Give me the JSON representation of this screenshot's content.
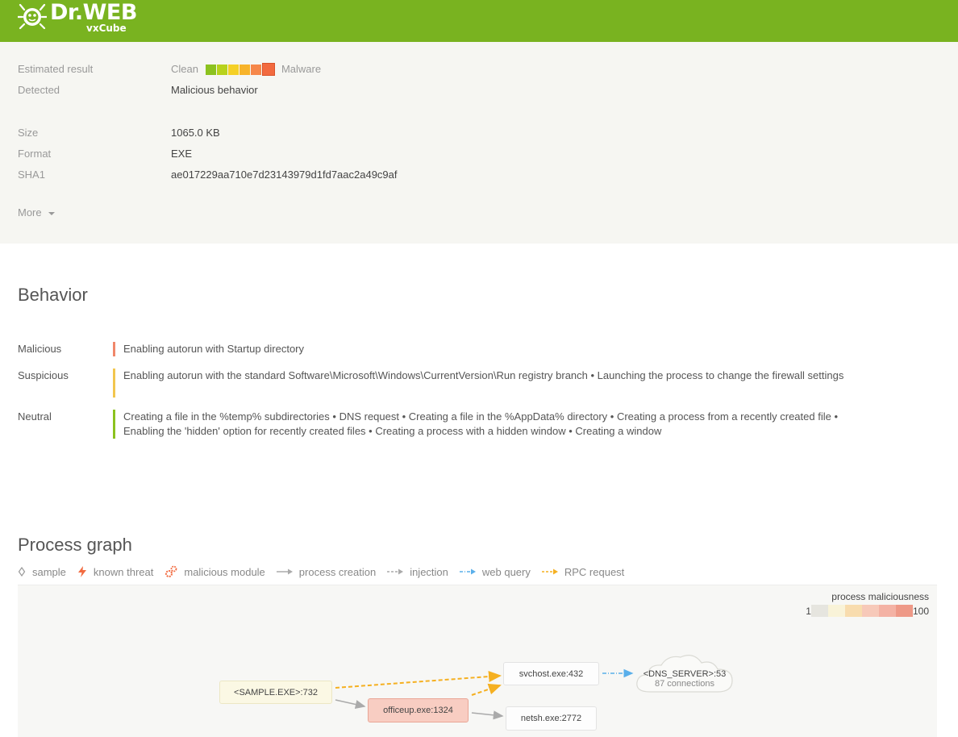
{
  "header": {
    "brand": "Dr.WEB",
    "product": "vxCube"
  },
  "summary": {
    "estimated_result": {
      "label": "Estimated result",
      "clean_label": "Clean",
      "malware_label": "Malware",
      "scale_colors": [
        "#8cc21f",
        "#b8d21c",
        "#f5d026",
        "#f7b32a",
        "#f6874a",
        "#f26a3f"
      ],
      "active_index": 5
    },
    "detected": {
      "label": "Detected",
      "value": "Malicious behavior"
    },
    "size": {
      "label": "Size",
      "value": "1065.0 KB"
    },
    "format": {
      "label": "Format",
      "value": "EXE"
    },
    "sha1": {
      "label": "SHA1",
      "value": "ae017229aa710e7d23143979d1fd7aac2a49c9af"
    },
    "more_label": "More"
  },
  "behavior": {
    "title": "Behavior",
    "categories": [
      {
        "name": "Malicious",
        "color": "#f0876a",
        "text": "Enabling autorun with Startup directory"
      },
      {
        "name": "Suspicious",
        "color": "#f2c64e",
        "text": "Enabling autorun with the standard Software\\Microsoft\\Windows\\CurrentVersion\\Run registry branch • Launching the process to change the firewall settings"
      },
      {
        "name": "Neutral",
        "color": "#8cc21f",
        "text": "Creating a file in the %temp% subdirectories • DNS request • Creating a file in the %AppData% directory • Creating a process from a recently created file • Enabling the 'hidden' option for recently created files • Creating a process with a hidden window • Creating a window"
      }
    ]
  },
  "process_graph": {
    "title": "Process graph",
    "legend": {
      "sample": "sample",
      "known_threat": "known threat",
      "malicious_module": "malicious module",
      "process_creation": "process creation",
      "injection": "injection",
      "web_query": "web query",
      "rpc_request": "RPC request"
    },
    "maliciousness": {
      "title": "process maliciousness",
      "min": "1",
      "max": "100",
      "colors": [
        "#e6e5df",
        "#f9f3d8",
        "#f8dcae",
        "#f7c9b9",
        "#f4b2a4",
        "#ee9987"
      ]
    },
    "nodes": {
      "sample": "<SAMPLE.EXE>:732",
      "svchost": "svchost.exe:432",
      "officeup": "officeup.exe:1324",
      "netsh": "netsh.exe:2772",
      "dns_server": "<DNS_SERVER>:53",
      "dns_connections": "87 connections"
    },
    "colors": {
      "rpc": "#f5b021",
      "web_query": "#5aafea",
      "process_creation": "#aaaaaa"
    }
  }
}
